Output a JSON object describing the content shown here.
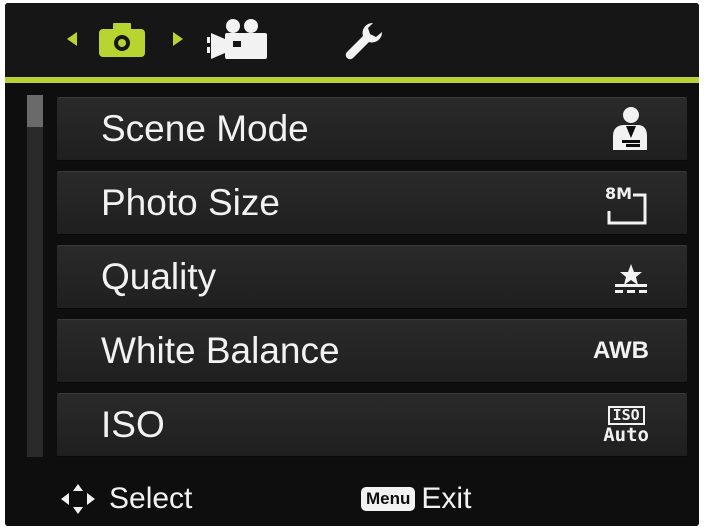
{
  "tabs": [
    {
      "name": "camera-tab",
      "icon": "camera-icon",
      "active": true
    },
    {
      "name": "video-tab",
      "icon": "video-camera-icon",
      "active": false
    },
    {
      "name": "setup-tab",
      "icon": "wrench-icon",
      "active": false
    }
  ],
  "accent_color": "#b8d430",
  "menu": {
    "items": [
      {
        "label": "Scene Mode",
        "value_icon": "portrait-scene-icon"
      },
      {
        "label": "Photo Size",
        "value_text": "8M",
        "value_icon": "image-size-icon"
      },
      {
        "label": "Quality",
        "value_icon": "quality-stars-icon"
      },
      {
        "label": "White Balance",
        "value_text": "AWB"
      },
      {
        "label": "ISO",
        "value_top": "ISO",
        "value_bottom": "Auto"
      }
    ]
  },
  "footer": {
    "select_label": "Select",
    "menu_key": "Menu",
    "exit_label": "Exit"
  }
}
